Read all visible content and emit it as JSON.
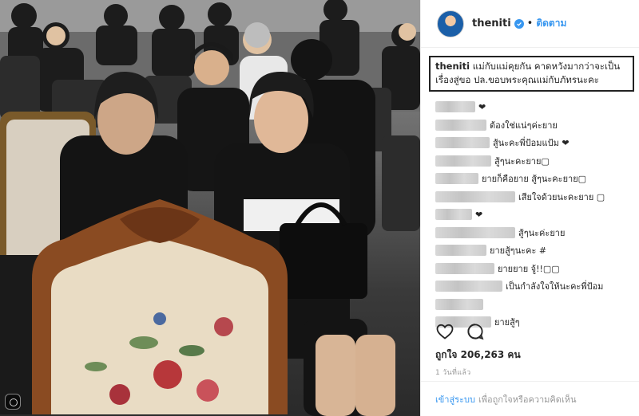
{
  "post": {
    "username": "theniti",
    "separator": "•",
    "follow_label": "ติดตาม",
    "caption_user": "theniti",
    "caption_line1": "แม่กับแม่คุยกัน คาดหวังมากว่าจะเป็น",
    "caption_line2": "เรื่องสู่ขอ ปล.ขอบพระคุณแม่กับภัทรนะคะ",
    "likes_text": "ถูกใจ 206,263 คน",
    "time_ago": "1 วันที่แล้ว",
    "login_label": "เข้าสู่ระบบ",
    "login_suffix": "เพื่อถูกใจหรือความคิดเห็น"
  },
  "comments": [
    {
      "text": "❤"
    },
    {
      "text": "ต้องใช่แน่ๆค่ะยาย"
    },
    {
      "text": "สู้นะคะพี่ป้อมแป้ม ❤"
    },
    {
      "text": "สู้ๆนะคะยาย▢"
    },
    {
      "text": "ยายก็คือยาย สู้ๆนะคะยาย▢"
    },
    {
      "text": "เสียใจด้วยนะคะยาย ▢"
    },
    {
      "text": "❤"
    },
    {
      "text": "สู้ๆนะค่ะยาย"
    },
    {
      "text": "ยายสู้ๆนะคะ #"
    },
    {
      "text": "ยายยาย จู้!!▢▢"
    },
    {
      "text": "เป็นกำลังใจให้นะคะพี่ป้อม"
    },
    {
      "text": ""
    },
    {
      "text": "ยายสู้ๆ"
    }
  ],
  "colors": {
    "accent": "#3897f0",
    "text": "#262626",
    "muted": "#999999"
  },
  "icons": {
    "like": "heart-icon",
    "comment": "comment-icon",
    "verified": "verified-badge-icon"
  }
}
